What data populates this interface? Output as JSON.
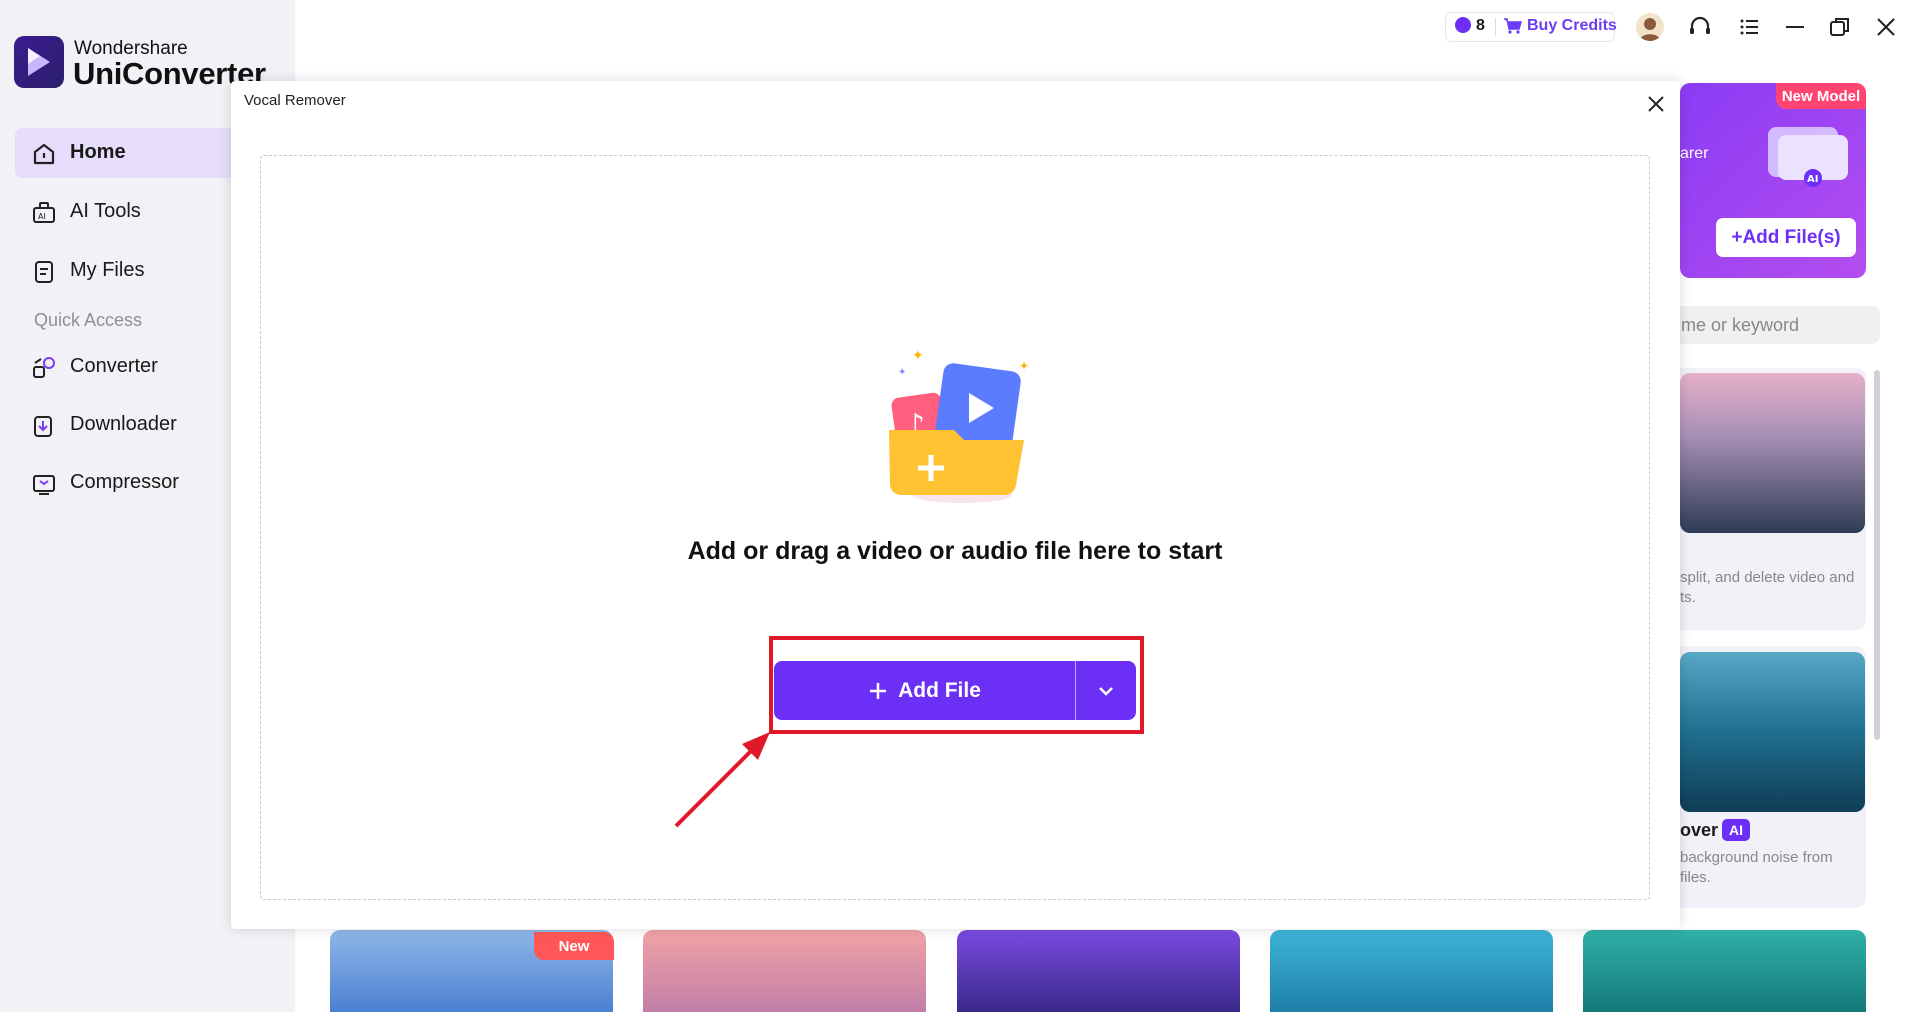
{
  "app": {
    "brand_small": "Wondershare",
    "brand_big": "UniConverter"
  },
  "sidebar": {
    "items": [
      {
        "label": "Home",
        "icon": "home-icon",
        "active": true
      },
      {
        "label": "AI Tools",
        "icon": "ai-tools-icon",
        "active": false
      },
      {
        "label": "My Files",
        "icon": "files-icon",
        "active": false
      }
    ],
    "quick_access_label": "Quick Access",
    "quick_items": [
      {
        "label": "Converter",
        "icon": "converter-icon"
      },
      {
        "label": "Downloader",
        "icon": "downloader-icon"
      },
      {
        "label": "Compressor",
        "icon": "compressor-icon"
      }
    ]
  },
  "topbar": {
    "credits": "8",
    "buy_credits": "Buy Credits",
    "icons": [
      "avatar",
      "headset-icon",
      "menu-icon",
      "minimize-icon",
      "restore-icon",
      "close-icon"
    ]
  },
  "background": {
    "banner_badge": "New Model",
    "banner_text": "arer",
    "add_files_label": "+Add File(s)",
    "search_placeholder": "me or keyword",
    "card1_desc_line1": "split, and delete video and",
    "card1_desc_line2": "ts.",
    "card2_title": "over",
    "card2_badge": "AI",
    "card2_desc_line1": "background noise from",
    "card2_desc_line2": "files.",
    "bottom_new_tag": "New"
  },
  "modal": {
    "title": "Vocal Remover",
    "drop_text": "Add or drag a video or audio file here to start",
    "add_file_label": "Add File"
  },
  "colors": {
    "accent": "#6b2ff5",
    "highlight": "#e0192a",
    "sidebar_bg": "#f1f1f6"
  }
}
